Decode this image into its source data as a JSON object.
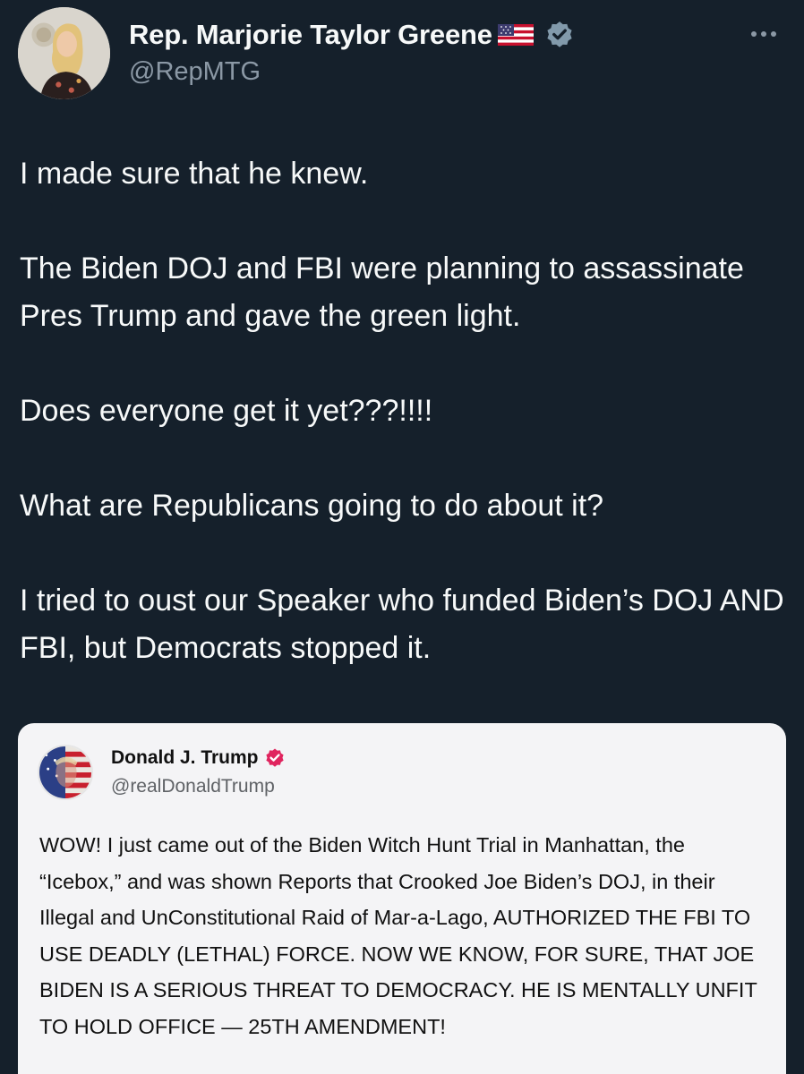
{
  "tweet": {
    "author": {
      "display_name": "Rep. Marjorie Taylor Greene",
      "handle": "@RepMTG",
      "flag": "us-flag-emoji",
      "verified": true
    },
    "paragraphs": [
      "I made sure that he knew.",
      "The Biden DOJ and FBI were planning to assassinate Pres Trump and gave the green light.",
      "Does everyone get it yet???!!!!",
      "What are Republicans going to do about it?",
      "I tried to oust our Speaker who funded Biden’s DOJ AND FBI, but Democrats stopped it."
    ]
  },
  "quoted_post": {
    "author": {
      "display_name": "Donald J. Trump",
      "handle": "@realDonaldTrump",
      "verified": true
    },
    "text": "WOW! I just came out of the Biden Witch Hunt Trial in Manhattan, the “Icebox,” and was shown Reports that Crooked Joe Biden’s DOJ, in their Illegal and UnConstitutional Raid of Mar-a-Lago, AUTHORIZED THE FBI TO USE DEADLY (LETHAL) FORCE. NOW WE KNOW, FOR SURE, THAT JOE BIDEN IS A SERIOUS THREAT TO DEMOCRACY. HE IS MENTALLY UNFIT TO HOLD OFFICE — 25TH AMENDMENT!"
  },
  "icons": {
    "more": "more-horizontal-icon",
    "verified": "verified-badge-icon"
  },
  "colors": {
    "background": "#15202b",
    "text_primary": "#f7f9f9",
    "text_secondary": "#8b98a5",
    "verified_badge": "#829aab",
    "quote_card_bg": "#f4f4f6",
    "quote_verified": "#e0245e"
  }
}
